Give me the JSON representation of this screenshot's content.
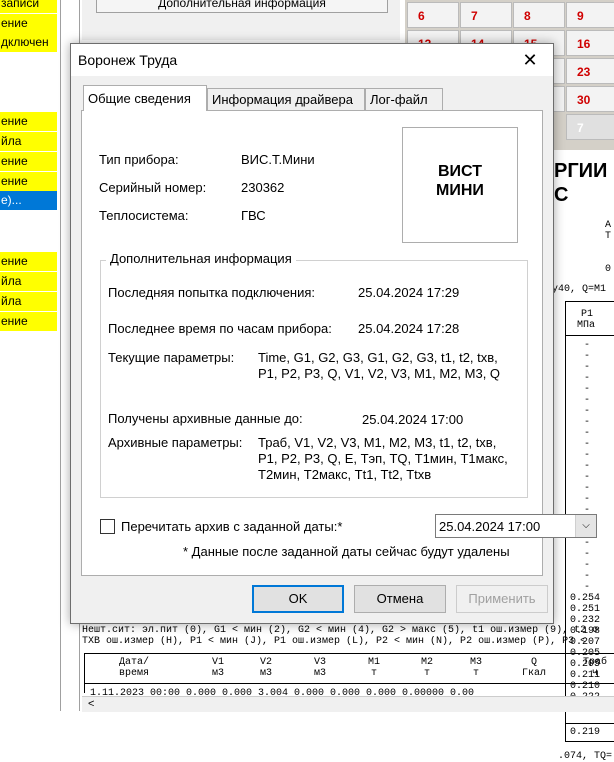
{
  "background": {
    "left_list": [
      {
        "text": "записи",
        "hl": true
      },
      {
        "text": "ение",
        "hl": true
      },
      {
        "text": "дключен",
        "hl": true
      },
      {
        "text": "ение",
        "hl": true
      },
      {
        "text": "йла",
        "hl": true
      },
      {
        "text": "ение",
        "hl": true
      },
      {
        "text": "ение",
        "hl": true
      },
      {
        "text": "е)...",
        "hl": false,
        "sel": true
      },
      {
        "text": "ение",
        "hl": true
      },
      {
        "text": "йла",
        "hl": true
      },
      {
        "text": "йла",
        "hl": true
      },
      {
        "text": "ение",
        "hl": true
      }
    ],
    "top_panel_button": "Дополнительная информация",
    "calendar_numbers": [
      "6",
      "7",
      "8",
      "9",
      "13",
      "14",
      "15",
      "16",
      "20",
      "21",
      "22",
      "23",
      "27",
      "28",
      "29",
      "30",
      "7"
    ],
    "report_heading": [
      "РГИИ",
      "С"
    ],
    "report_side_labels": [
      "А",
      "Т",
      "0"
    ],
    "report_formula": "у40, Q=M1",
    "report_col": {
      "title": "P1",
      "unit": "МПа"
    },
    "report_values": [
      "0.254",
      "0.251",
      "0.232",
      "0.198",
      "0.207",
      "0.205",
      "0.205",
      "0.211",
      "0.210",
      "0.222",
      "0.251"
    ],
    "report_total": "0.219",
    "report_footer_line": ".074, TQ=",
    "notes_line1": "Нешт.сит: эл.пит (0), G1 < мин (2), G2 < мин (4), G2 > макс (5), t1 ош.измер (9), t2 о",
    "notes_line2": "ТХВ ош.измер (Н), P1 < мин (J), P1 ош.измер (L), P2 < мин (N), P2 ош.измер (P), P3 <",
    "table_headers": [
      {
        "name": "Дата/",
        "unit": "время"
      },
      {
        "name": "V1",
        "unit": "м3"
      },
      {
        "name": "V2",
        "unit": "м3"
      },
      {
        "name": "V3",
        "unit": "м3"
      },
      {
        "name": "M1",
        "unit": "т"
      },
      {
        "name": "M2",
        "unit": "т"
      },
      {
        "name": "M3",
        "unit": "т"
      },
      {
        "name": "Q",
        "unit": "Гкал"
      },
      {
        "name": "Траб",
        "unit": "ч"
      }
    ],
    "table_row_partial": "1.11.2023 00:00   0.000   0.000   3.004   0.000   0.000   0.000  0.00000   0.00"
  },
  "dialog": {
    "title": "Воронеж Труда",
    "close_glyph": "✕",
    "tabs": [
      {
        "label": "Общие сведения",
        "active": true
      },
      {
        "label": "Информация драйвера",
        "active": false
      },
      {
        "label": "Лог-файл",
        "active": false
      }
    ],
    "device": {
      "type_label": "Тип прибора:",
      "type_value": "ВИС.Т.Мини",
      "serial_label": "Серийный номер:",
      "serial_value": "230362",
      "system_label": "Теплосистема:",
      "system_value": "ГВС"
    },
    "logo": {
      "line1": "ВИСТ",
      "line2": "МИНИ"
    },
    "extra_group": {
      "title": "Дополнительная информация",
      "last_attempt_label": "Последняя попытка подключения:",
      "last_attempt_value": "25.04.2024  17:29",
      "last_time_label": "Последнее время по часам прибора:",
      "last_time_value": "25.04.2024  17:28",
      "current_params_label": "Текущие параметры:",
      "current_params_line1": "Time, G1, G2, G3, G1, G2, G3, t1, t2, txв,",
      "current_params_line2": "P1, P2, P3, Q, V1, V2, V3, M1, M2, M3, Q",
      "archive_until_label": "Получены архивные данные до:",
      "archive_until_value": "25.04.2024  17:00",
      "archive_params_label": "Архивные параметры:",
      "archive_params_line1": "Траб, V1, V2, V3, M1, M2, M3, t1, t2, txв,",
      "archive_params_line2": "P1, P2, P3, Q, E, Тэп, TQ, Т1мин, Т1макс,",
      "archive_params_line3": "Т2мин, Т2макс, Tt1, Tt2, Ttxв"
    },
    "reread": {
      "checkbox_label": "Перечитать архив с заданной даты:*",
      "checked": false,
      "date_value": "25.04.2024  17:00",
      "note": "* Данные после заданной даты сейчас будут удалены"
    },
    "buttons": {
      "ok": "OK",
      "cancel": "Отмена",
      "apply": "Применить"
    }
  },
  "colors": {
    "highlight": "#ffff00",
    "selection": "#0078d7",
    "calendar_text": "#d00000"
  }
}
